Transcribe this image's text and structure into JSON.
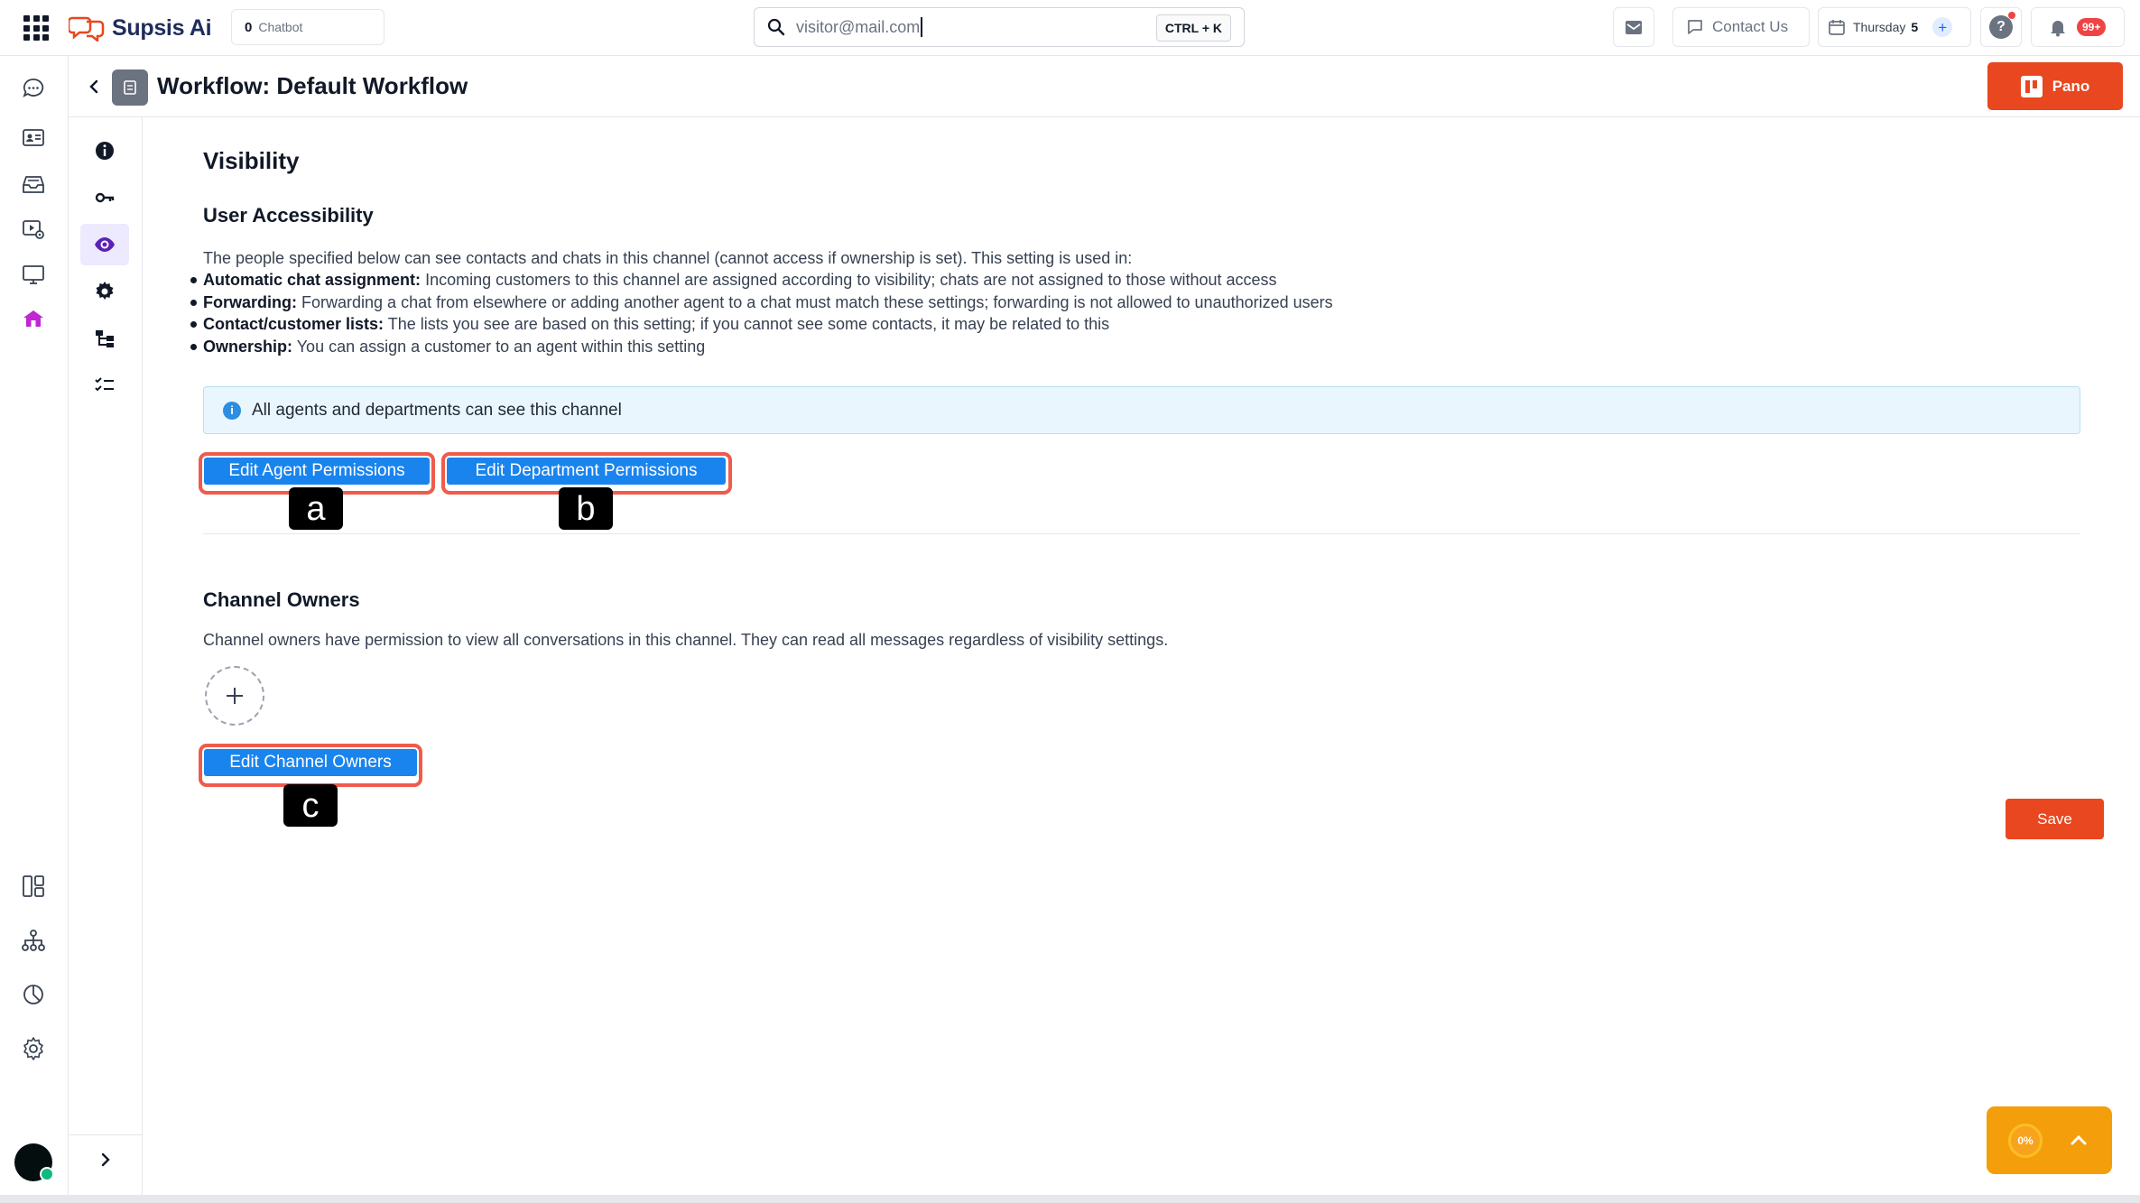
{
  "topbar": {
    "brand": "Supsis Ai",
    "chatbot_count": "0",
    "chatbot_label": "Chatbot",
    "search_value": "visitor@mail.com",
    "search_shortcut": "CTRL + K",
    "contact_label": "Contact Us",
    "date_day": "Thursday",
    "date_num": "5",
    "date_plus": "+",
    "help_label": "?",
    "notification_badge": "99+"
  },
  "header": {
    "title": "Workflow: Default Workflow",
    "pano_label": "Pano"
  },
  "visibility": {
    "heading": "Visibility",
    "subheading": "User Accessibility",
    "description": "The people specified below can see contacts and chats in this channel (cannot access if ownership is set). This setting is used in:",
    "bullets": [
      {
        "title": "Automatic chat assignment:",
        "text": "Incoming customers to this channel are assigned according to visibility; chats are not assigned to those without access"
      },
      {
        "title": "Forwarding:",
        "text": "Forwarding a chat from elsewhere or adding another agent to a chat must match these settings; forwarding is not allowed to unauthorized users"
      },
      {
        "title": "Contact/customer lists:",
        "text": "The lists you see are based on this setting; if you cannot see some contacts, it may be related to this"
      },
      {
        "title": "Ownership:",
        "text": "You can assign a customer to an agent within this setting"
      }
    ],
    "info_icon": "i",
    "info_text": "All agents and departments can see this channel",
    "edit_agent_label": "Edit Agent Permissions",
    "edit_department_label": "Edit Department Permissions"
  },
  "owners": {
    "heading": "Channel Owners",
    "description": "Channel owners have permission to view all conversations in this channel. They can read all messages regardless of visibility settings.",
    "edit_owners_label": "Edit Channel Owners"
  },
  "annotations": {
    "a": "a",
    "b": "b",
    "c": "c"
  },
  "save_label": "Save",
  "progress": {
    "label": "0%",
    "value": 0
  },
  "colors": {
    "accent_orange": "#e8471f",
    "primary_blue": "#1a84ee",
    "highlight_red": "#ef5b4c",
    "active_purple": "#5b21b6",
    "info_bg": "#eaf6fd",
    "widget_orange": "#f59e0b"
  },
  "icons": {
    "topbar": [
      "apps-grid-icon",
      "supsis-logo-icon",
      "search-icon",
      "mail-icon",
      "chat-bubble-icon",
      "calendar-icon",
      "help-icon",
      "bell-icon"
    ],
    "sidebar": [
      "chat-icon",
      "contacts-icon",
      "inbox-icon",
      "media-settings-icon",
      "monitor-icon",
      "home-icon",
      "layout-icon",
      "hierarchy-icon",
      "reports-icon",
      "settings-icon",
      "collapse-icon"
    ],
    "rail": [
      "info-icon",
      "key-icon",
      "eye-icon",
      "gear-icon",
      "workflow-icon",
      "checklist-icon",
      "chevron-right-icon"
    ]
  }
}
